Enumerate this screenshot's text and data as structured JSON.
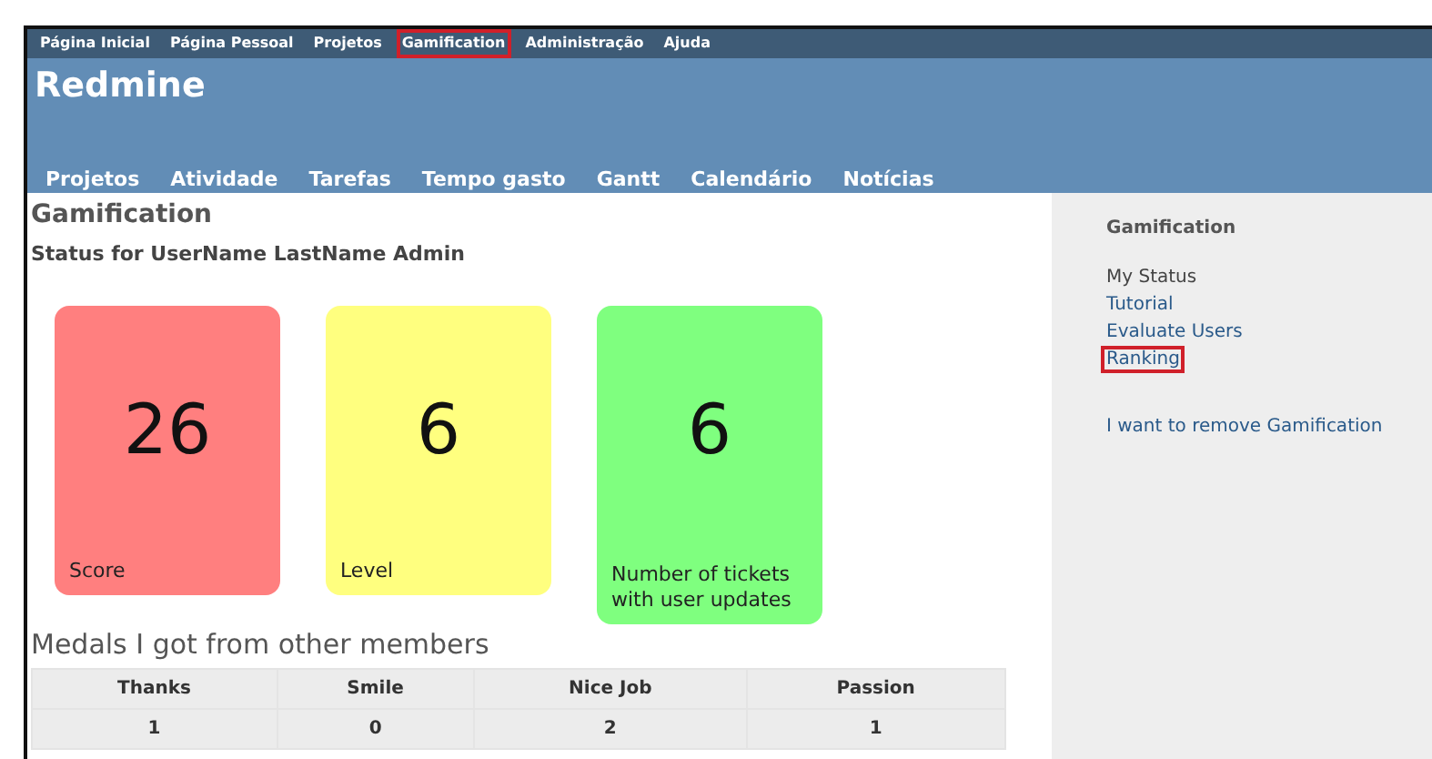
{
  "top_menu": [
    {
      "label": "Página Inicial",
      "highlighted": false
    },
    {
      "label": "Página Pessoal",
      "highlighted": false
    },
    {
      "label": "Projetos",
      "highlighted": false
    },
    {
      "label": "Gamification",
      "highlighted": true
    },
    {
      "label": "Administração",
      "highlighted": false
    },
    {
      "label": "Ajuda",
      "highlighted": false
    }
  ],
  "site_title": "Redmine",
  "main_menu": [
    "Projetos",
    "Atividade",
    "Tarefas",
    "Tempo gasto",
    "Gantt",
    "Calendário",
    "Notícias"
  ],
  "page_title": "Gamification",
  "status_heading": "Status for UserName LastName Admin",
  "stat_cards": [
    {
      "value": "26",
      "label": "Score",
      "color": "#ff7f7f"
    },
    {
      "value": "6",
      "label": "Level",
      "color": "#ffff7f"
    },
    {
      "value": "6",
      "label": "Number of tickets with user updates",
      "color": "#7fff7f"
    }
  ],
  "medals_heading": "Medals I got from other members",
  "medals_table": {
    "columns": [
      "Thanks",
      "Smile",
      "Nice Job",
      "Passion"
    ],
    "rows": [
      [
        "1",
        "0",
        "2",
        "1"
      ]
    ]
  },
  "sidebar": {
    "title": "Gamification",
    "links": [
      {
        "label": "My Status",
        "kind": "current",
        "highlighted": false
      },
      {
        "label": "Tutorial",
        "kind": "link",
        "highlighted": false
      },
      {
        "label": "Evaluate Users",
        "kind": "link",
        "highlighted": false
      },
      {
        "label": "Ranking",
        "kind": "link",
        "highlighted": true
      }
    ],
    "remove_link": "I want to remove Gamification"
  }
}
